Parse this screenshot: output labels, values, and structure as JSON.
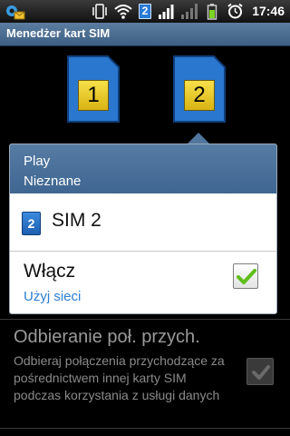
{
  "status_bar": {
    "time": "17:46",
    "sim_indicator": "2",
    "icons": [
      "settings-notification-icon",
      "vibrate-icon",
      "wifi-icon",
      "sim-2-icon",
      "signal-icon",
      "signal-empty-icon",
      "battery-icon",
      "alarm-icon"
    ]
  },
  "app": {
    "title": "Menedżer kart SIM"
  },
  "sim_cards": [
    {
      "number": "1",
      "color": "#2a77cf"
    },
    {
      "number": "2",
      "color": "#2a77cf"
    }
  ],
  "popup": {
    "operator": "Play",
    "status": "Nieznane",
    "sim_icon_label": "2",
    "sim_name": "SIM 2",
    "enable_label": "Włącz",
    "enable_sub": "Użyj sieci",
    "enable_checked": true
  },
  "incoming_calls": {
    "title": "Odbieranie poł. przych.",
    "description": "Odbieraj połączenia przychodzące za pośrednictwem innej karty SIM podczas korzystania z usługi danych",
    "checked": true,
    "enabled": false
  },
  "colors": {
    "accent_blue": "#2c7fd4",
    "header_blue": "#4a70998",
    "chip_yellow": "#e6c824"
  }
}
